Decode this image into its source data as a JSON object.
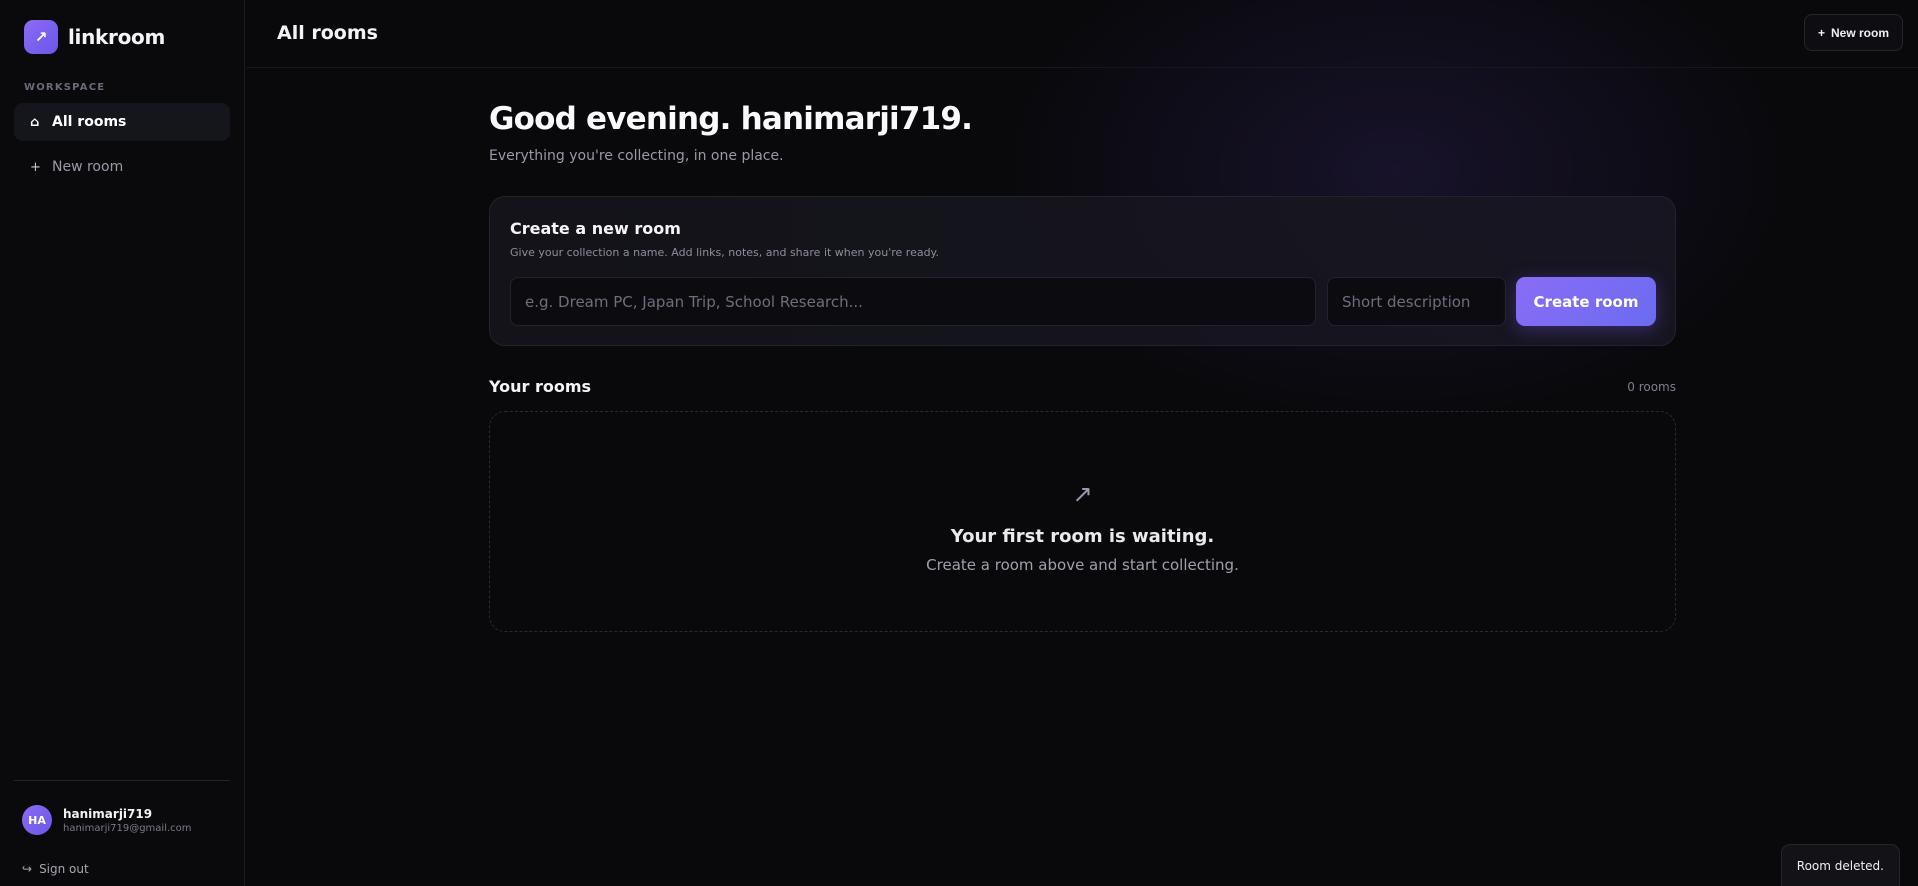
{
  "brand": {
    "name": "linkroom",
    "logo_glyph": "↗"
  },
  "sidebar": {
    "section_label": "WORKSPACE",
    "items": [
      {
        "label": "All rooms",
        "icon": "home-icon",
        "glyph": "⌂",
        "active": true
      },
      {
        "label": "New room",
        "icon": "plus-icon",
        "glyph": "+",
        "active": false
      }
    ],
    "user": {
      "initials": "HA",
      "name": "hanimarji719",
      "email": "hanimarji719@gmail.com"
    },
    "signout": {
      "label": "Sign out",
      "glyph": "↪"
    }
  },
  "topbar": {
    "title": "All rooms",
    "new_room_label": "New room",
    "new_room_glyph": "+"
  },
  "main": {
    "greeting": "Good evening. hanimarji719.",
    "subtitle": "Everything you're collecting, in one place.",
    "create_card": {
      "title": "Create a new room",
      "subtitle": "Give your collection a name. Add links, notes, and share it when you're ready.",
      "name_placeholder": "e.g. Dream PC, Japan Trip, School Research...",
      "desc_placeholder": "Short description",
      "button_label": "Create room"
    },
    "rooms": {
      "title": "Your rooms",
      "count_label": "0 rooms",
      "empty": {
        "icon_glyph": "↗",
        "title": "Your first room is waiting.",
        "subtitle": "Create a room above and start collecting."
      }
    }
  },
  "toast": {
    "message": "Room deleted."
  },
  "colors": {
    "accent": "#8b6cf6",
    "accent_2": "#6a6cf0",
    "background": "#09090c"
  }
}
